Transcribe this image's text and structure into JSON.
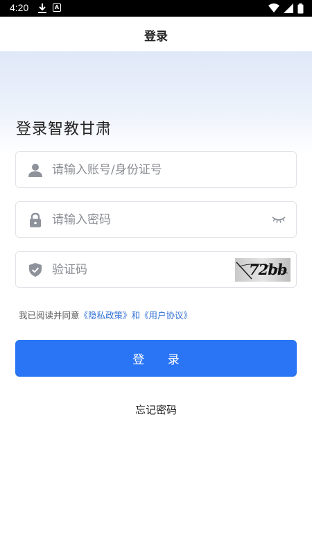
{
  "status_bar": {
    "time": "4:20"
  },
  "header": {
    "title": "登录"
  },
  "welcome": "登录智教甘肃",
  "form": {
    "account_placeholder": "请输入账号/身份证号",
    "password_placeholder": "请输入密码",
    "captcha_placeholder": "验证码",
    "captcha_text": "72bb"
  },
  "agreement": {
    "prefix": "我已阅读并同意",
    "privacy_link": "《隐私政策》",
    "and": "和",
    "terms_link": "《用户协议》"
  },
  "login_button": "登 录",
  "forgot_password": "忘记密码",
  "colors": {
    "primary": "#2a75f5",
    "link": "#2f6fd6",
    "icon": "#8d929b"
  }
}
